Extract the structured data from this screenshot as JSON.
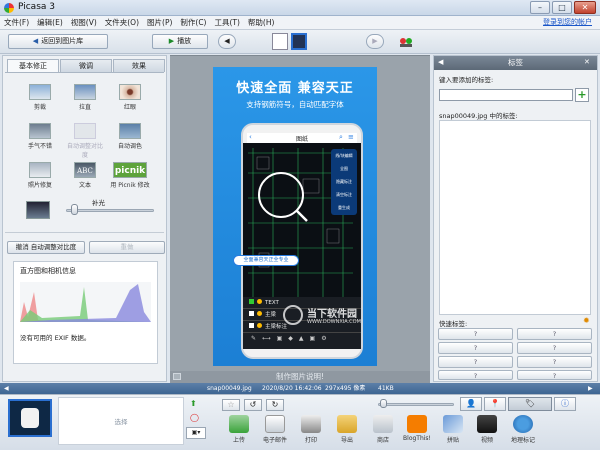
{
  "window": {
    "title": "Picasa 3",
    "min": "–",
    "max": "□",
    "close": "✕"
  },
  "menu": [
    "文件(F)",
    "编辑(E)",
    "视图(V)",
    "文件夹(O)",
    "图片(P)",
    "制作(C)",
    "工具(T)",
    "帮助(H)"
  ],
  "signin": "登录到您的帐户",
  "toolbar": {
    "back_label": "返回到图片库",
    "play_label": "播放"
  },
  "left": {
    "tabs": [
      "基本修正",
      "微调",
      "效果"
    ],
    "tools": [
      {
        "label": "剪裁",
        "icon": "crop-icon"
      },
      {
        "label": "拉直",
        "icon": "straighten-icon"
      },
      {
        "label": "红眼",
        "icon": "redeye-icon"
      },
      {
        "label": "手气不错",
        "icon": "lucky-icon"
      },
      {
        "label": "自动调整对比度",
        "icon": "auto-contrast-icon",
        "disabled": true
      },
      {
        "label": "自动调色",
        "icon": "auto-color-icon"
      },
      {
        "label": "照片修复",
        "icon": "retouch-icon"
      },
      {
        "label": "文本",
        "icon": "text-icon"
      },
      {
        "label": "用 Picnik 修改",
        "icon": "picnik-icon"
      }
    ],
    "fill_label": "补光",
    "fill_level": 0.06,
    "undo_label": "撤消 自动调整对比度",
    "redo_label": "重做",
    "histogram_title": "直方图和相机信息",
    "exif_text": "没有可用的 EXIF 数据。"
  },
  "preview": {
    "headline": "快速全面 兼容天正",
    "subline": "支持钢筋符号，自动匹配字体",
    "phone_title": "图纸",
    "menu_items": [
      "线/块编辑",
      "全图",
      "隐藏标注",
      "清空标注",
      "重生成"
    ],
    "callout": "全面兼容天正全专业",
    "layers": [
      "TEXT",
      "主梁",
      "主梁标注"
    ],
    "watermark": "当下软件园",
    "watermark_url": "WWW.DOWNXIA.COM",
    "caption": "制作图片说明!"
  },
  "right": {
    "title": "标签",
    "add_tag_label": "键入要添加的标签:",
    "add_button": "+",
    "file_tags": "snap00049.jpg 中的标签:",
    "quick_tags_label": "快速标签:",
    "quick_tags": [
      "?",
      "?",
      "?",
      "?",
      "?",
      "?",
      "?",
      "?",
      "?",
      "?"
    ]
  },
  "status": {
    "filename": "snap00049.jpg",
    "datetime": "2020/8/20 16:42:06",
    "dimensions": "297x495 像素",
    "size": "41KB"
  },
  "tray": {
    "selection_label": "选择",
    "actions": [
      {
        "label": "上传",
        "icon": "upload-icon"
      },
      {
        "label": "电子邮件",
        "icon": "email-icon"
      },
      {
        "label": "打印",
        "icon": "print-icon"
      },
      {
        "label": "导出",
        "icon": "export-icon"
      },
      {
        "label": "商店",
        "icon": "shop-icon"
      },
      {
        "label": "BlogThis!",
        "icon": "blogger-icon"
      },
      {
        "label": "拼贴",
        "icon": "collage-icon"
      },
      {
        "label": "视频",
        "icon": "movie-icon"
      },
      {
        "label": "地理标记",
        "icon": "geotag-icon"
      }
    ]
  },
  "colors": {
    "accent": "#3d6592",
    "preview_bg": "#9aa3ab",
    "promo_blue": "#1c7fd4"
  }
}
